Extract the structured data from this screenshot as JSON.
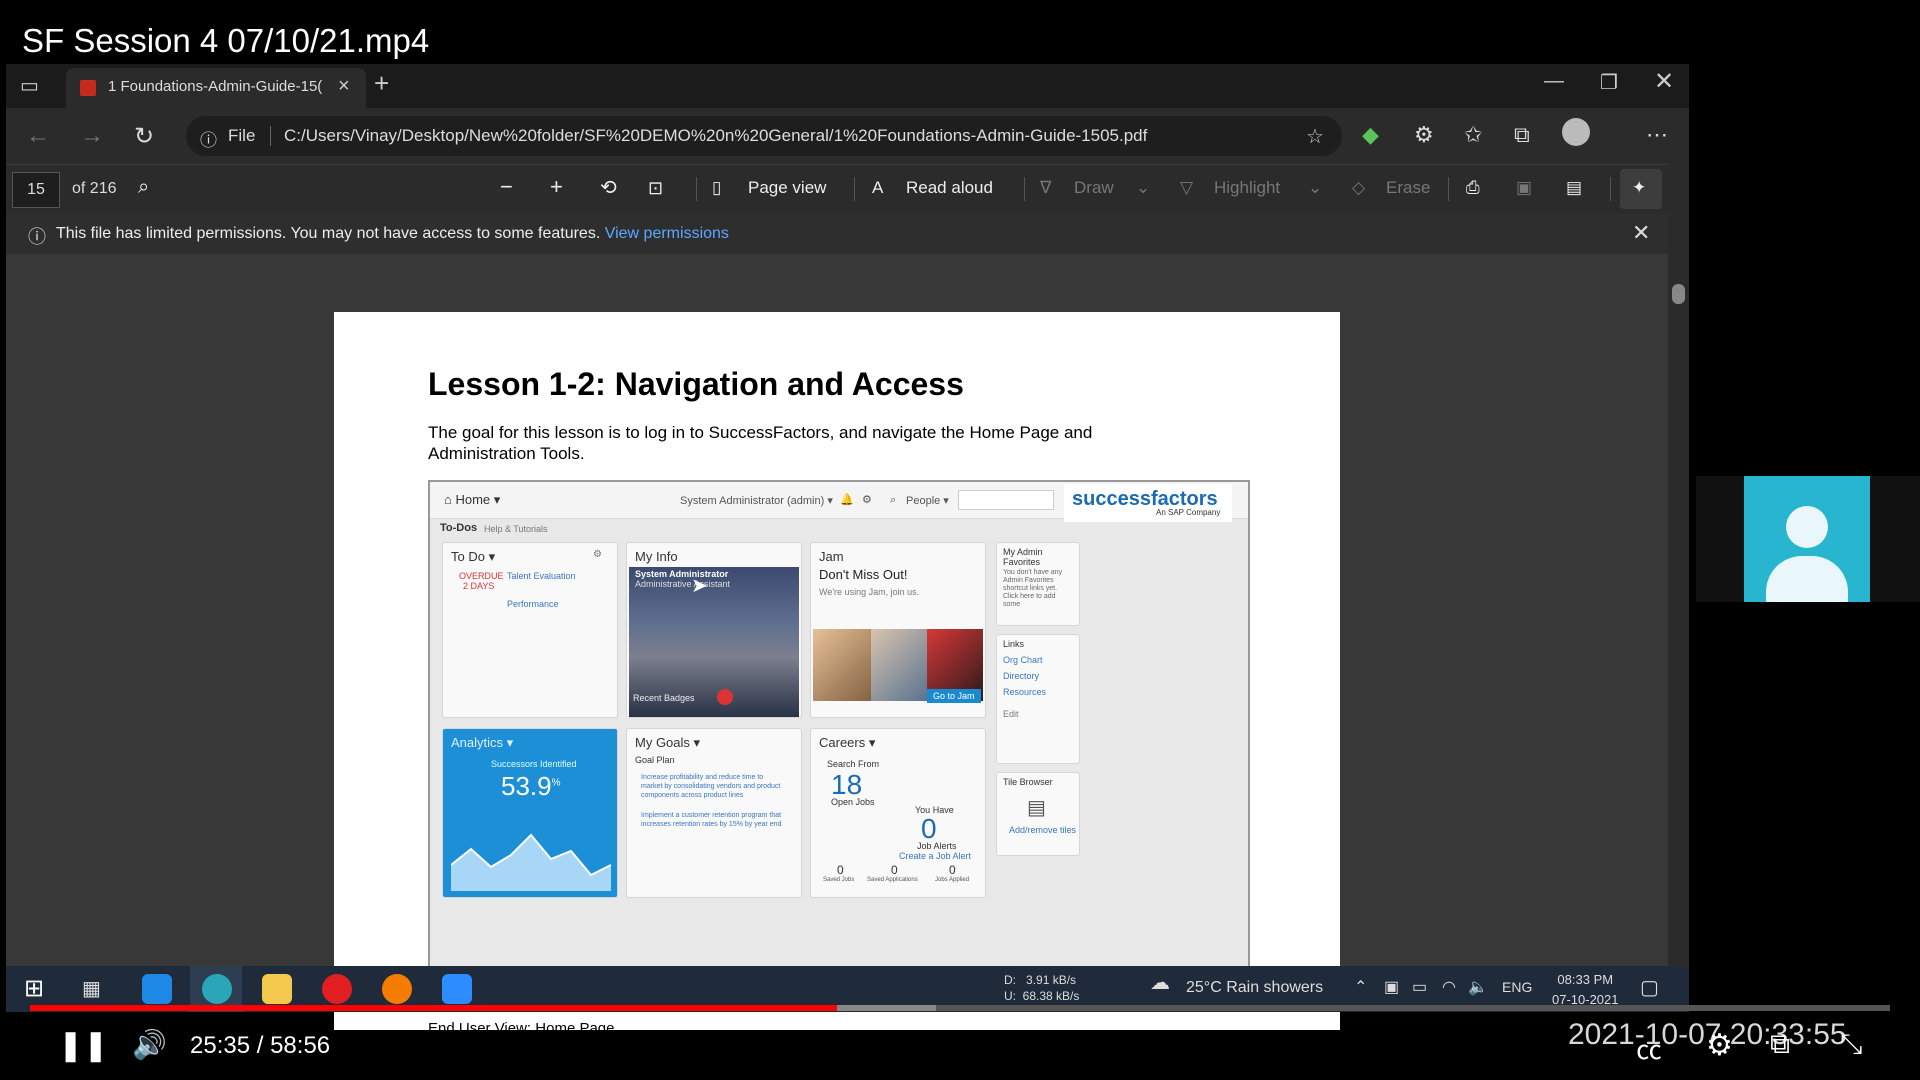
{
  "video": {
    "title": "SF Session 4 07/10/21.mp4",
    "current_time": "25:35",
    "time_sep": "/",
    "duration": "58:56",
    "progress": 0.434,
    "buffered": 0.487,
    "timestamp_overlay": "2021-10-07 20:33:55"
  },
  "browser": {
    "tab_title": "1 Foundations-Admin-Guide-15(",
    "address_label": "File",
    "url": "C:/Users/Vinay/Desktop/New%20folder/SF%20DEMO%20n%20General/1%20Foundations-Admin-Guide-1505.pdf"
  },
  "pdf_toolbar": {
    "page_number": "15",
    "page_total": "of 216",
    "page_view": "Page view",
    "read_aloud": "Read aloud",
    "draw": "Draw",
    "highlight": "Highlight",
    "erase": "Erase"
  },
  "infobar": {
    "message": "This file has limited permissions. You may not have access to some features.",
    "link": "View permissions"
  },
  "pdf_page": {
    "title": "Lesson 1-2: Navigation and Access",
    "body": "The goal for this lesson is to log in to SuccessFactors, and navigate the Home Page and Administration Tools.",
    "caption": "End User View:  Home Page"
  },
  "sf_screenshot": {
    "home": "Home ▾",
    "todos": "To-Dos",
    "help": "Help & Tutorials",
    "user": "System Administrator (admin) ▾",
    "people": "People ▾",
    "logo": "successfactors",
    "logo_sub": "An SAP Company",
    "todo_title": "To Do ▾",
    "overdue": "OVERDUE",
    "days": "2 DAYS",
    "talent_eval": "Talent Evaluation",
    "performance": "Performance",
    "myinfo_title": "My Info",
    "myinfo_name": "System Administrator",
    "myinfo_role": "Administrative Assistant",
    "recent_badges": "Recent Badges",
    "jam_title": "Jam",
    "jam_headline": "Don't Miss Out!",
    "jam_sub": "We're using Jam, join us.",
    "jam_button": "Go to Jam",
    "admin_fav_title": "My Admin Favorites",
    "admin_fav_text": "You don't have any Admin Favorites shortcut links yet. Click here to add some",
    "links_title": "Links",
    "link1": "Org Chart",
    "link2": "Directory",
    "link3": "Resources",
    "edit": "Edit",
    "analytics_title": "Analytics ▾",
    "analytics_label": "Successors Identified",
    "analytics_value": "53.9",
    "analytics_unit": "%",
    "goals_title": "My Goals ▾",
    "goal_plan": "Goal Plan",
    "goal1": "Increase profitability and reduce time to market by consolidating vendors and product components across product lines",
    "goal2": "Implement a customer retention program that increases retention rates by 15% by year end",
    "careers_title": "Careers ▾",
    "search_from": "Search From",
    "open_jobs_value": "18",
    "open_jobs": "Open Jobs",
    "you_have": "You Have",
    "job_alerts_value": "0",
    "job_alerts": "Job Alerts",
    "create_alert": "Create a Job Alert",
    "saved_jobs_value": "0",
    "saved_jobs": "Saved Jobs",
    "saved_apps_value": "0",
    "saved_apps": "Saved Applications",
    "jobs_applied_value": "0",
    "jobs_applied": "Jobs Applied",
    "tile_browser": "Tile Browser",
    "add_remove": "Add/remove tiles"
  },
  "taskbar": {
    "net_d": "D:",
    "net_d_val": "3.91 kB/s",
    "net_u": "U:",
    "net_u_val": "68.38 kB/s",
    "weather": "25°C  Rain showers",
    "lang": "ENG",
    "clock_time": "08:33 PM",
    "clock_date": "07-10-2021"
  },
  "colors": {
    "progress": "#ff0000",
    "link": "#5aa8ff",
    "sf_blue": "#1a6bb3",
    "camera_tile": "#27b5cf"
  }
}
